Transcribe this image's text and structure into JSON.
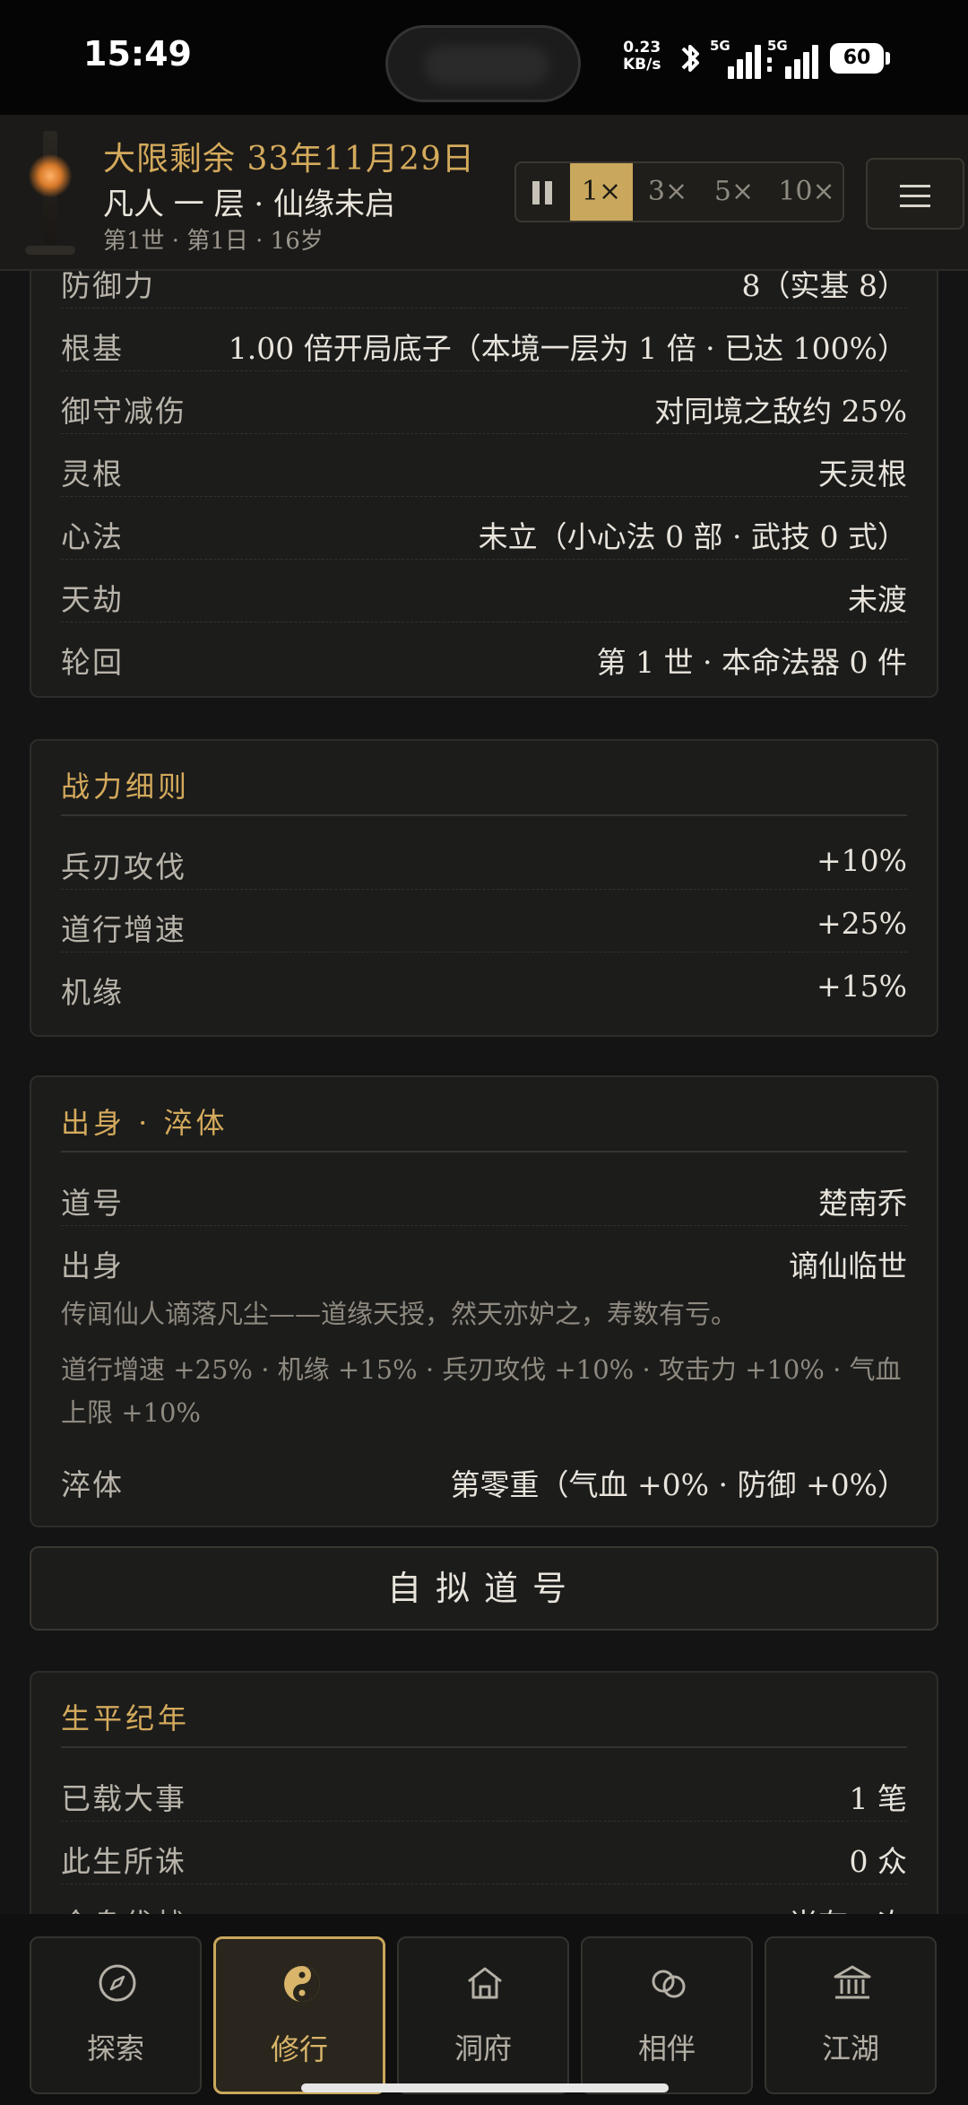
{
  "status_bar": {
    "time": "15:49",
    "net_speed_value": "0.23",
    "net_speed_unit": "KB/s",
    "sim1_label": "5G",
    "sim2_label": "5G",
    "battery": "60"
  },
  "header": {
    "lifespan": "大限剩余 33年11月29日",
    "realm": "凡人 一 层 · 仙缘未启",
    "meta": "第1世 · 第1日 · 16岁",
    "speeds": [
      "1×",
      "3×",
      "5×",
      "10×"
    ],
    "active_speed": "1×"
  },
  "stats_card": {
    "cut_row": {
      "label": "防御力",
      "value": "8（实基 8）"
    },
    "rows": [
      {
        "label": "根基",
        "value": "1.00 倍开局底子（本境一层为 1 倍 · 已达 100%）"
      },
      {
        "label": "御守减伤",
        "value": "对同境之敌约 25%"
      },
      {
        "label": "灵根",
        "value": "天灵根"
      },
      {
        "label": "心法",
        "value": "未立（小心法 0 部 · 武技 0 式）"
      },
      {
        "label": "天劫",
        "value": "未渡"
      },
      {
        "label": "轮回",
        "value": "第 1 世 · 本命法器 0 件"
      }
    ]
  },
  "combat_card": {
    "title": "战力细则",
    "rows": [
      {
        "label": "兵刃攻伐",
        "value": "+10%"
      },
      {
        "label": "道行增速",
        "value": "+25%"
      },
      {
        "label": "机缘",
        "value": "+15%"
      }
    ]
  },
  "origin_card": {
    "title": "出身 · 淬体",
    "rows": [
      {
        "label": "道号",
        "value": "楚南乔"
      },
      {
        "label": "出身",
        "value": "谪仙临世"
      }
    ],
    "description": "传闻仙人谪落凡尘——道缘天授，然天亦妒之，寿数有亏。",
    "bonuses": "道行增速 +25% · 机缘 +15% · 兵刃攻伐 +10% · 攻击力 +10% · 气血上限 +10%",
    "temper": {
      "label": "淬体",
      "value": "第零重（气血 +0% · 防御 +0%）"
    }
  },
  "custom_name_button": "自拟道号",
  "chronicle_card": {
    "title": "生平纪年",
    "rows": [
      {
        "label": "已载大事",
        "value": "1 笔"
      },
      {
        "label": "此生所诛",
        "value": "0 众"
      }
    ],
    "cut_row": {
      "label": "全身伐战",
      "value": "尚存一次"
    }
  },
  "bottom_nav": {
    "tabs": [
      {
        "label": "探索",
        "icon": "compass-icon"
      },
      {
        "label": "修行",
        "icon": "yin-yang-icon"
      },
      {
        "label": "洞府",
        "icon": "house-icon"
      },
      {
        "label": "相伴",
        "icon": "rings-icon"
      },
      {
        "label": "江湖",
        "icon": "temple-icon"
      }
    ],
    "active": "修行"
  },
  "colors": {
    "accent_gold": "#d4aa5c",
    "active_speed_bg": "#c9a75c",
    "background": "#141414",
    "card": "#1c1c1b"
  }
}
